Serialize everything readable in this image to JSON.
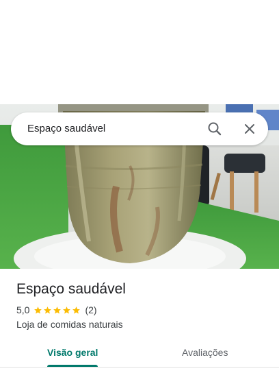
{
  "search": {
    "query": "Espaço saudável",
    "search_icon": "search-icon",
    "close_icon": "close-icon"
  },
  "photo": {
    "subject": "place-photo"
  },
  "place": {
    "name": "Espaço saudável",
    "rating": "5,0",
    "rating_stars": 5,
    "review_count": "(2)",
    "category": "Loja de comidas naturais"
  },
  "tabs": [
    {
      "label": "Visão geral",
      "selected": true
    },
    {
      "label": "Avaliações",
      "selected": false
    }
  ],
  "colors": {
    "accent": "#00796b",
    "star": "#fbbc04",
    "text_primary": "#202124",
    "text_secondary": "#3c4043"
  }
}
